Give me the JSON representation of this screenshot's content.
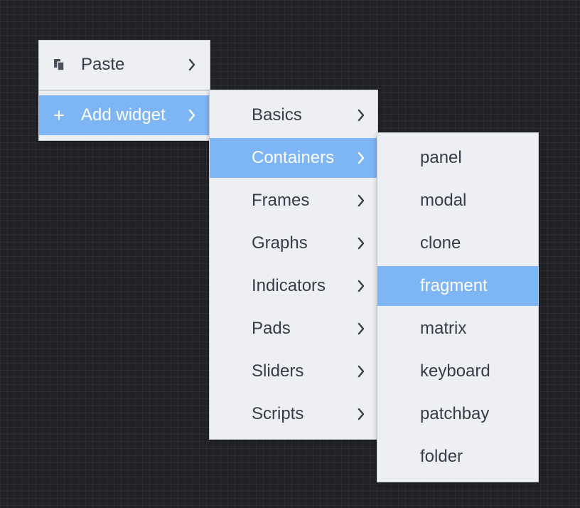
{
  "menu_main": {
    "items": [
      {
        "label": "Paste",
        "icon": "paste-icon"
      },
      {
        "label": "Add widget",
        "icon": "plus-icon"
      }
    ]
  },
  "menu_widgets": {
    "items": [
      {
        "label": "Basics"
      },
      {
        "label": "Containers"
      },
      {
        "label": "Frames"
      },
      {
        "label": "Graphs"
      },
      {
        "label": "Indicators"
      },
      {
        "label": "Pads"
      },
      {
        "label": "Sliders"
      },
      {
        "label": "Scripts"
      }
    ]
  },
  "menu_containers": {
    "items": [
      {
        "label": "panel"
      },
      {
        "label": "modal"
      },
      {
        "label": "clone"
      },
      {
        "label": "fragment"
      },
      {
        "label": "matrix"
      },
      {
        "label": "keyboard"
      },
      {
        "label": "patchbay"
      },
      {
        "label": "folder"
      }
    ]
  },
  "colors": {
    "background": "#202226",
    "menu_bg": "#edeff3",
    "highlight": "#7eb5f5",
    "text": "#363c48"
  }
}
